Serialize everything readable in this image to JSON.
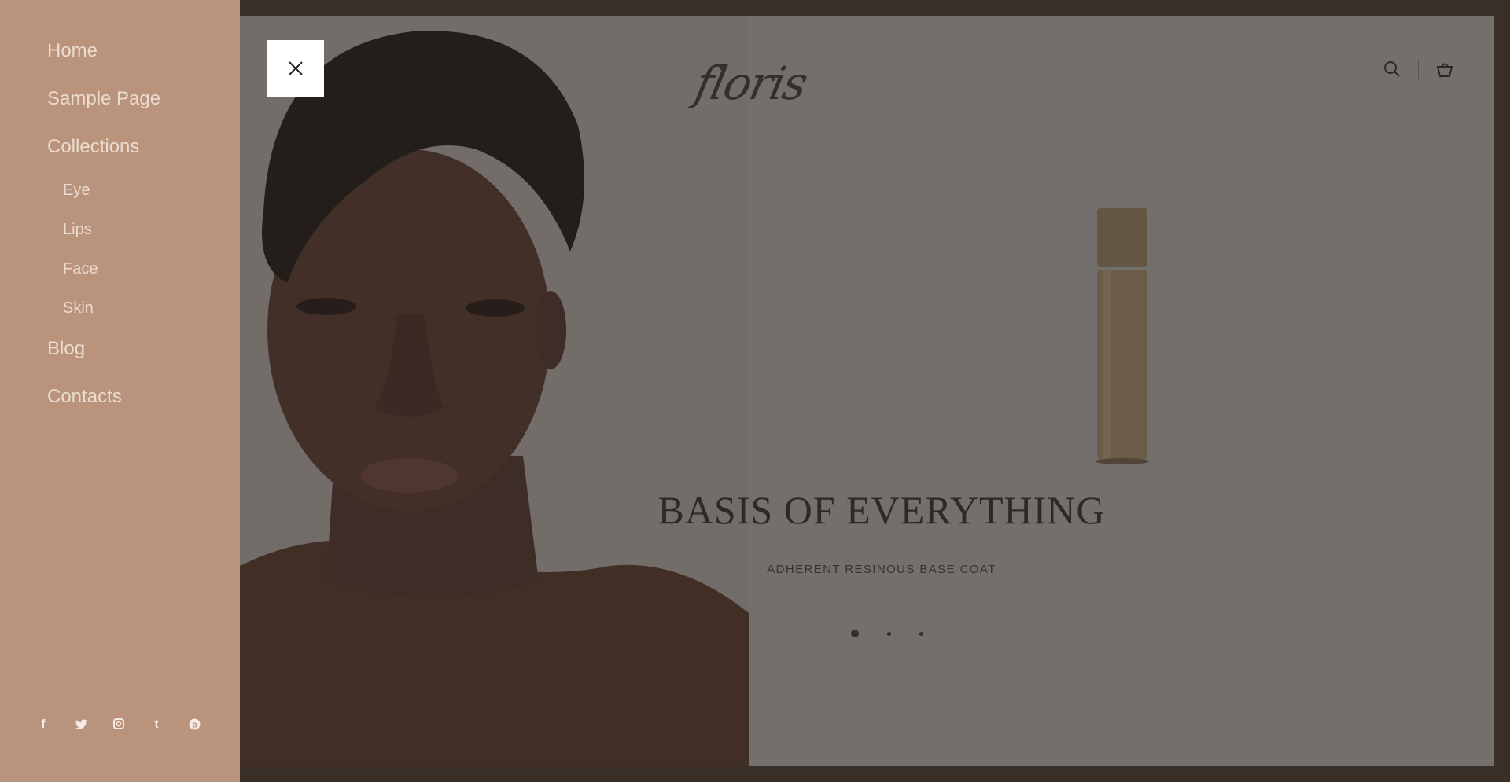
{
  "sidebar": {
    "items": [
      {
        "label": "Home"
      },
      {
        "label": "Sample Page"
      },
      {
        "label": "Collections",
        "children": [
          {
            "label": "Eye"
          },
          {
            "label": "Lips"
          },
          {
            "label": "Face"
          },
          {
            "label": "Skin"
          }
        ]
      },
      {
        "label": "Blog"
      },
      {
        "label": "Contacts"
      }
    ],
    "socials": [
      "facebook-icon",
      "twitter-icon",
      "instagram-icon",
      "tumblr-icon",
      "pinterest-icon"
    ]
  },
  "header": {
    "logo": "floris",
    "icons": [
      "search-icon",
      "cart-icon"
    ]
  },
  "slider": {
    "title": "BASIS OF EVERYTHING",
    "subtitle": "ADHERENT RESINOUS BASE COAT",
    "dots": 3,
    "active_dot": 1
  },
  "colors": {
    "sidebar_bg": "#b9937b",
    "frame_bg": "#4a3a2f",
    "menu_text": "#ecdcd0"
  }
}
